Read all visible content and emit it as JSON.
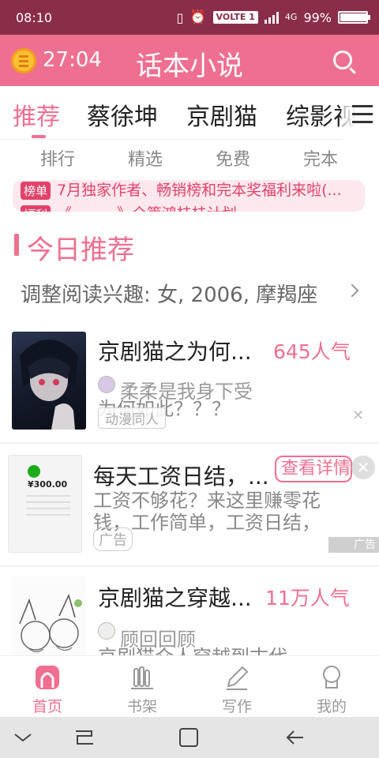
{
  "status_bar": {
    "time": "08:10",
    "network_label": "VOLTE 1",
    "signal_type": "4G",
    "battery_percent": "99%",
    "battery_level": 0.99
  },
  "header": {
    "timer": "27:04",
    "title": "话本小说",
    "icons": {
      "left": "coin-icon",
      "right": "search-icon"
    }
  },
  "tabs": {
    "items": [
      "推荐",
      "蔡徐坤",
      "京剧猫",
      "综影视"
    ],
    "active_index": 0
  },
  "subcategories": [
    "排行",
    "精选",
    "免费",
    "完本"
  ],
  "banner": {
    "lines": [
      {
        "tag": "榜单",
        "text": "7月独家作者、畅销榜和完本奖福利来啦(..."
      },
      {
        "tag": "福利",
        "text": "《一一一》全篇鸿桂桂计划"
      }
    ]
  },
  "today": {
    "title": "今日推荐",
    "interest_text": "调整阅读兴趣: 女, 2006, 摩羯座"
  },
  "books": [
    {
      "title": "京剧猫之为何...",
      "popularity": "645人气",
      "author": "柔柔是我身下受",
      "description": "为何如此？？？",
      "tag": "动漫同人"
    },
    {
      "title": "每天工资日结，...",
      "description": "工资不够花？来这里赚零花钱，工作简单，工资日结，随...",
      "ad_button": "查看详情",
      "ad_label": "广告",
      "ad_mark": "广告",
      "receipt_amount": "¥300.00"
    },
    {
      "title": "京剧猫之穿越...",
      "popularity": "11万人气",
      "author": "顾回回顾",
      "description": "京剧猫众人穿越到古代"
    }
  ],
  "bottom_nav": {
    "items": [
      {
        "label": "首页",
        "icon": "home-icon"
      },
      {
        "label": "书架",
        "icon": "bookshelf-icon"
      },
      {
        "label": "写作",
        "icon": "pen-icon"
      },
      {
        "label": "我的",
        "icon": "profile-icon"
      }
    ],
    "active_index": 0
  },
  "colors": {
    "accent": "#ef6f90",
    "status_bar": "#8a2d48",
    "banner_text": "#e2436a"
  }
}
